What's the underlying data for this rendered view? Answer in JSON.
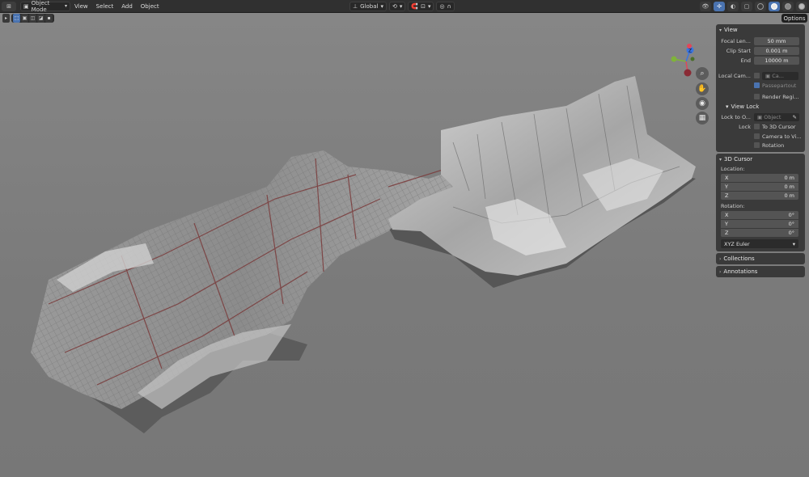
{
  "header": {
    "mode": "Object Mode",
    "menus": [
      "View",
      "Select",
      "Add",
      "Object"
    ],
    "transform_orientation": "Global"
  },
  "viewport": {
    "options_label": "Options"
  },
  "gizmo": {
    "x": "X",
    "y": "Y",
    "z": "Z"
  },
  "npanel": {
    "view": {
      "title": "View",
      "focal_length_label": "Focal Len...",
      "focal_length": "50 mm",
      "clip_start_label": "Clip Start",
      "clip_start": "0.001 m",
      "end_label": "End",
      "end": "10000 m",
      "local_camera_label": "Local Cam...",
      "local_camera_value": "Ca...",
      "passepartout": "Passepartout",
      "render_region": "Render Regi...",
      "view_lock_title": "View Lock",
      "lock_to_object_label": "Lock to O...",
      "lock_to_object_placeholder": "Object",
      "lock_label": "Lock",
      "lock_to_cursor": "To 3D Cursor",
      "camera_to_view": "Camera to Vi...",
      "rotation": "Rotation"
    },
    "cursor": {
      "title": "3D Cursor",
      "location_label": "Location:",
      "loc_x_label": "X",
      "loc_x": "0 m",
      "loc_y_label": "Y",
      "loc_y": "0 m",
      "loc_z_label": "Z",
      "loc_z": "0 m",
      "rotation_label": "Rotation:",
      "rot_x_label": "X",
      "rot_x": "0°",
      "rot_y_label": "Y",
      "rot_y": "0°",
      "rot_z_label": "Z",
      "rot_z": "0°",
      "rotation_mode": "XYZ Euler"
    },
    "collections_title": "Collections",
    "annotations_title": "Annotations"
  },
  "colors": {
    "accent": "#4a73b0",
    "axis_x": "#e0475a",
    "axis_y": "#7fb33a",
    "axis_z": "#3a74e0"
  }
}
